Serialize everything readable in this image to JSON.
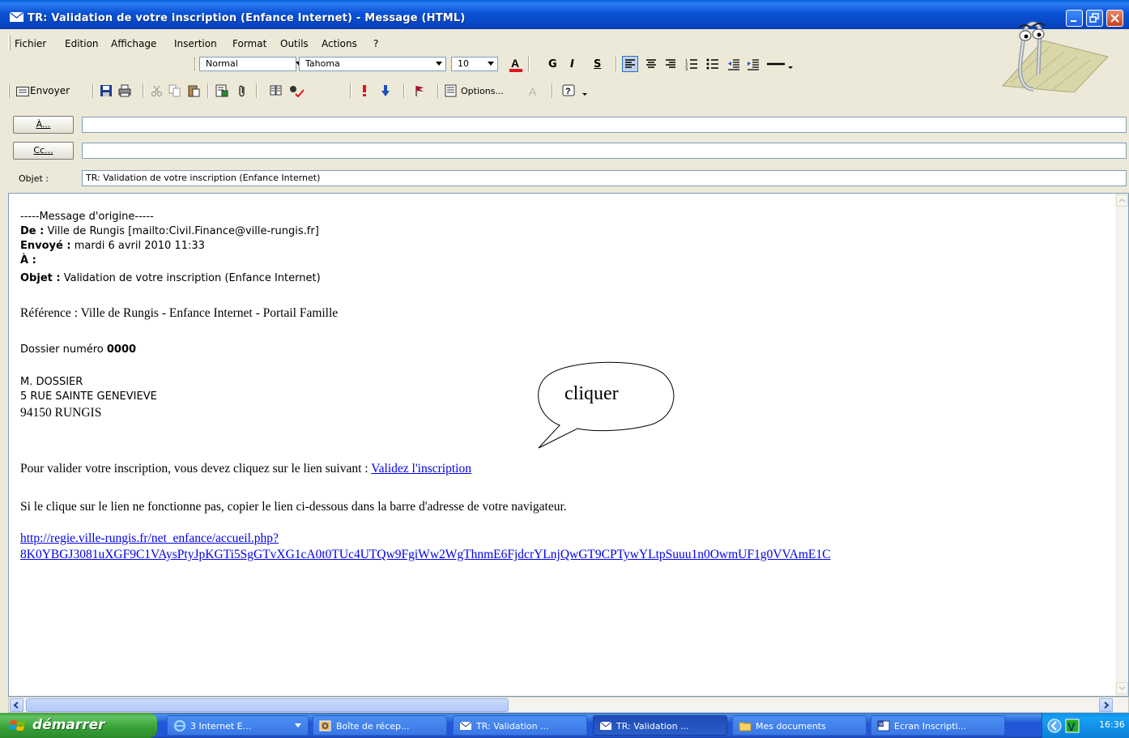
{
  "window": {
    "title": "TR: Validation de votre inscription (Enfance Internet) - Message (HTML)"
  },
  "menu": [
    "Fichier",
    "Edition",
    "Affichage",
    "Insertion",
    "Format",
    "Outils",
    "Actions",
    "?"
  ],
  "format_toolbar": {
    "style": "Normal",
    "font": "Tahoma",
    "size": "10",
    "bold": "G",
    "italic": "I",
    "underline": "S"
  },
  "standard_toolbar": {
    "send_label": "Envoyer",
    "options_label": "Options..."
  },
  "header": {
    "to_button": "À...",
    "cc_button": "Cc...",
    "to_value": "",
    "cc_value": "",
    "subject_label": "Objet :",
    "subject_value": "TR: Validation de votre inscription (Enfance Internet)"
  },
  "message": {
    "separator": "-----Message d'origine-----",
    "from_label": "De :",
    "from_value": "Ville de Rungis [mailto:Civil.Finance@ville-rungis.fr]",
    "sent_label": "Envoyé :",
    "sent_value": "mardi 6 avril 2010 11:33",
    "to_label": "À :",
    "subject_label": "Objet :",
    "subject_value": "Validation de votre inscription (Enfance Internet)",
    "reference": "Référence : Ville de Rungis - Enfance Internet - Portail Famille",
    "dossier_label": "Dossier numéro",
    "dossier_number": "0000",
    "address_name": "M. DOSSIER",
    "address_street": "5 RUE SAINTE GENEVIEVE",
    "address_city": "94150 RUNGIS",
    "validate_text": "Pour valider votre inscription, vous devez cliquez sur le lien suivant :",
    "validate_link": "Validez l'inscription",
    "fallback_text": "Si le clique sur le lien ne fonctionne pas, copier le lien ci-dessous dans la barre d'adresse de votre navigateur.",
    "url_line1": "http://regie.ville-rungis.fr/net_enfance/accueil.php?",
    "url_line2": "8K0YBGJ3081uXGF9C1VAysPtyJpKGTi5SgGTvXG1cA0t0TUc4UTQw9FgiWw2WgThnmE6FjdcrYLnjQwGT9CPTywYLtpSuuu1n0OwmUF1g0VVAmE1C"
  },
  "callout": {
    "text": "cliquer"
  },
  "taskbar": {
    "start_label": "démarrer",
    "tasks": [
      {
        "label": "3 Internet E...",
        "icon": "internet-explorer-icon"
      },
      {
        "label": "Boîte de récep...",
        "icon": "outlook-icon"
      },
      {
        "label": "TR: Validation ...",
        "icon": "mail-icon"
      },
      {
        "label": "TR: Validation ...",
        "icon": "mail-icon"
      },
      {
        "label": "Mes documents",
        "icon": "folder-icon"
      },
      {
        "label": "Ecran Inscripti...",
        "icon": "word-icon"
      }
    ],
    "clock": "16:36"
  }
}
